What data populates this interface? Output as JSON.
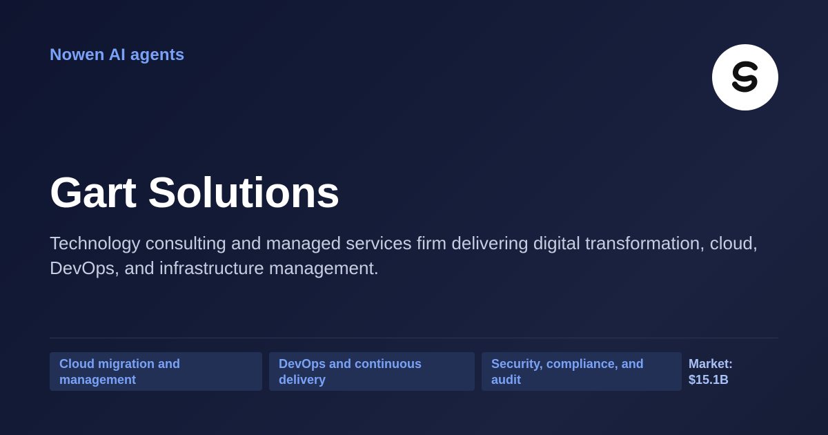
{
  "brand": {
    "label": "Nowen AI agents"
  },
  "company": {
    "name": "Gart Solutions",
    "description": "Technology consulting and managed services firm delivering digital transformation, cloud, DevOps, and infrastructure management.",
    "logo_icon": "gart-g-logo-icon"
  },
  "tags": [
    "Cloud migration and management",
    "DevOps and continuous delivery",
    "Security, compliance, and audit"
  ],
  "market": {
    "label": "Market:",
    "value": "$15.1B"
  },
  "colors": {
    "accent": "#7aa2f7",
    "tag_background": "#223056",
    "background": "#141c38"
  }
}
